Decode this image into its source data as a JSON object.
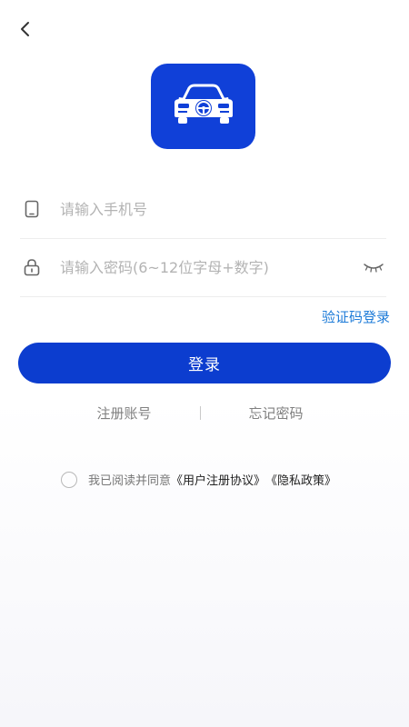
{
  "header": {
    "back_icon": "chevron-left-icon"
  },
  "logo": {
    "icon": "car-icon",
    "bg_color": "#1040d8"
  },
  "form": {
    "phone": {
      "icon": "phone-icon",
      "placeholder": "请输入手机号",
      "value": ""
    },
    "password": {
      "icon": "lock-icon",
      "placeholder": "请输入密码(6~12位字母+数字)",
      "value": "",
      "toggle_icon": "eye-closed-icon"
    },
    "sms_login_label": "验证码登录",
    "login_label": "登录"
  },
  "links": {
    "register_label": "注册账号",
    "forgot_label": "忘记密码"
  },
  "agreement": {
    "checked": false,
    "prefix": "我已阅读并同意",
    "user_agreement": "《用户注册协议》",
    "privacy_policy": "《隐私政策》"
  },
  "colors": {
    "primary": "#0c3dcf",
    "link": "#1d7bd8"
  }
}
